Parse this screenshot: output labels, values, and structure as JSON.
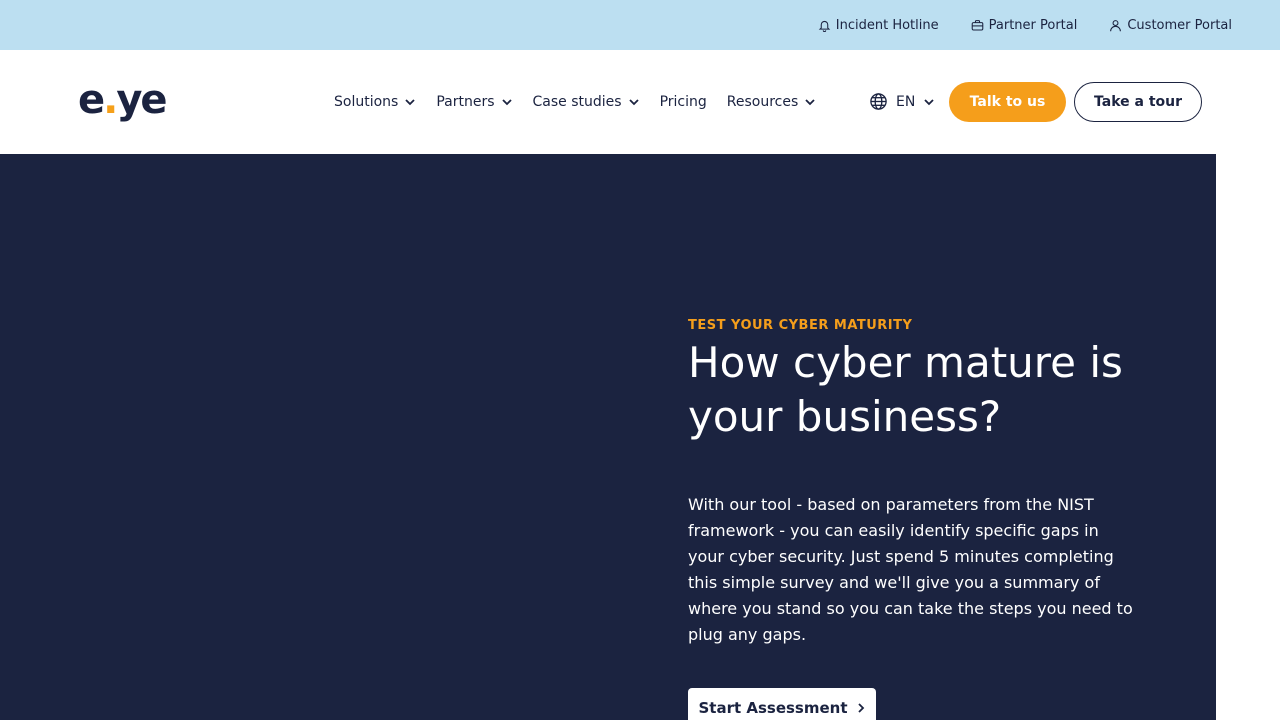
{
  "topbar": {
    "links": [
      {
        "label": "Incident Hotline",
        "icon": "bell-icon"
      },
      {
        "label": "Partner Portal",
        "icon": "briefcase-icon"
      },
      {
        "label": "Customer Portal",
        "icon": "user-icon"
      }
    ]
  },
  "header": {
    "logo": {
      "text_before": "e",
      "dot": ".",
      "text_after": "ye",
      "alt": "eye"
    },
    "nav": [
      {
        "label": "Solutions",
        "has_dropdown": true
      },
      {
        "label": "Partners",
        "has_dropdown": true
      },
      {
        "label": "Case studies",
        "has_dropdown": true
      },
      {
        "label": "Pricing",
        "has_dropdown": false
      },
      {
        "label": "Resources",
        "has_dropdown": true
      }
    ],
    "language": {
      "label": "EN",
      "icon": "globe-icon"
    },
    "talk_label": "Talk to us",
    "tour_label": "Take a tour"
  },
  "hero": {
    "eyebrow": "TEST YOUR CYBER MATURITY",
    "headline": "How cyber mature is your business?",
    "body": "With our tool - based on parameters from the NIST framework - you can easily identify specific gaps in your cyber security. Just spend 5 minutes completing this simple survey and we'll give you a summary of where you stand so you can take the steps you need to plug any gaps.",
    "cta_label": "Start Assessment"
  },
  "colors": {
    "topbar_bg": "#bcdff1",
    "navy": "#1b2340",
    "accent_orange": "#f59e1b",
    "white": "#ffffff"
  }
}
